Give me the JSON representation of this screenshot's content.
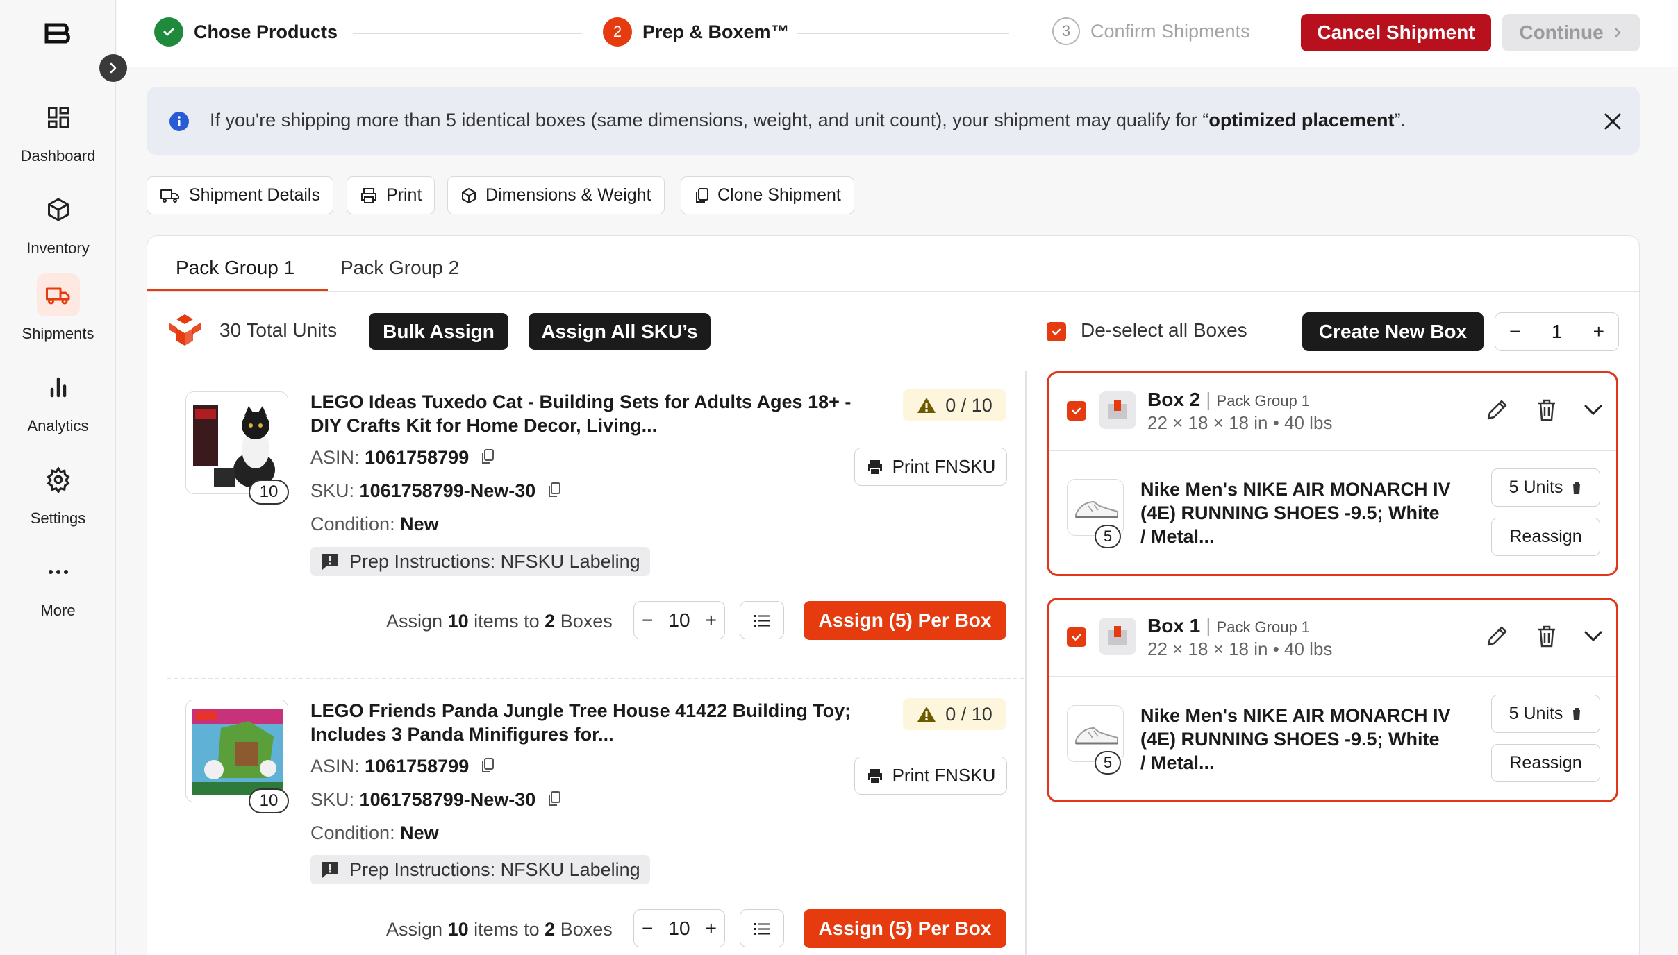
{
  "sidebar": {
    "items": [
      {
        "label": "Dashboard",
        "icon": "dashboard-icon"
      },
      {
        "label": "Inventory",
        "icon": "cube-icon"
      },
      {
        "label": "Shipments",
        "icon": "truck-icon",
        "active": true
      },
      {
        "label": "Analytics",
        "icon": "bar-chart-icon"
      },
      {
        "label": "Settings",
        "icon": "gear-icon"
      },
      {
        "label": "More",
        "icon": "more-dots-icon"
      }
    ]
  },
  "steps": [
    {
      "label": "Chose Products",
      "state": "done"
    },
    {
      "number": "2",
      "label": "Prep & Boxem™",
      "state": "current"
    },
    {
      "number": "3",
      "label": "Confirm Shipments",
      "state": "pending"
    }
  ],
  "header": {
    "cancel_label": "Cancel Shipment",
    "continue_label": "Continue"
  },
  "banner": {
    "text": "If you're shipping more than 5 identical boxes (same dimensions, weight, and unit count), your shipment may qualify for “",
    "bold": "optimized placement",
    "end": "”."
  },
  "toolbar": {
    "shipment_details": "Shipment Details",
    "print": "Print",
    "dimensions_weight": "Dimensions & Weight",
    "clone_shipment": "Clone Shipment"
  },
  "tabs": [
    "Pack Group 1",
    "Pack Group 2"
  ],
  "left_header": {
    "total_units": "30 Total Units",
    "bulk_assign": "Bulk Assign",
    "assign_all": "Assign All SKU’s"
  },
  "right_header": {
    "deselect": "De-select all Boxes",
    "create_box": "Create New Box",
    "box_count": "1"
  },
  "products": [
    {
      "title_line1": "LEGO Ideas Tuxedo Cat - Building Sets for Adults Ages 18+ -",
      "title_line2": "DIY Crafts Kit for Home Decor, Living...",
      "qty": "10",
      "progress": "0 / 10",
      "asin_label": "ASIN:",
      "asin": "1061758799",
      "sku_label": "SKU:",
      "sku": "1061758799-New-30",
      "condition_label": "Condition:",
      "condition": "New",
      "prep": "Prep Instructions: NFSKU Labeling",
      "print_label": "Print FNSKU",
      "assign_pre": "Assign",
      "assign_items": "10",
      "assign_mid": "items to",
      "assign_boxes": "2",
      "assign_post": "Boxes",
      "stepper_value": "10",
      "assign_button": "Assign (5) Per Box"
    },
    {
      "title_line1": "LEGO Friends Panda Jungle Tree House 41422 Building Toy;",
      "title_line2": "Includes 3 Panda Minifigures for...",
      "qty": "10",
      "progress": "0 / 10",
      "asin_label": "ASIN:",
      "asin": "1061758799",
      "sku_label": "SKU:",
      "sku": "1061758799-New-30",
      "condition_label": "Condition:",
      "condition": "New",
      "prep": "Prep Instructions: NFSKU Labeling",
      "print_label": "Print FNSKU",
      "assign_pre": "Assign",
      "assign_items": "10",
      "assign_mid": "items to",
      "assign_boxes": "2",
      "assign_post": "Boxes",
      "stepper_value": "10",
      "assign_button": "Assign (5) Per Box"
    }
  ],
  "boxes": [
    {
      "name": "Box 2",
      "group": "Pack Group 1",
      "dims": "22 × 18 × 18 in • 40 lbs",
      "item_line1": "Nike Men's NIKE AIR MONARCH IV",
      "item_line2": "(4E) RUNNING SHOES -9.5; White",
      "item_line3": "/ Metal...",
      "item_qty": "5",
      "units_label": "5 Units",
      "reassign": "Reassign"
    },
    {
      "name": "Box 1",
      "group": "Pack Group 1",
      "dims": "22 × 18 × 18 in • 40 lbs",
      "item_line1": "Nike Men's NIKE AIR MONARCH IV",
      "item_line2": "(4E) RUNNING SHOES -9.5; White",
      "item_line3": "/ Metal...",
      "item_qty": "5",
      "units_label": "5 Units",
      "reassign": "Reassign"
    }
  ],
  "colors": {
    "accent": "#e63a0f",
    "cancel": "#b8101c",
    "success": "#1f8a3c"
  }
}
